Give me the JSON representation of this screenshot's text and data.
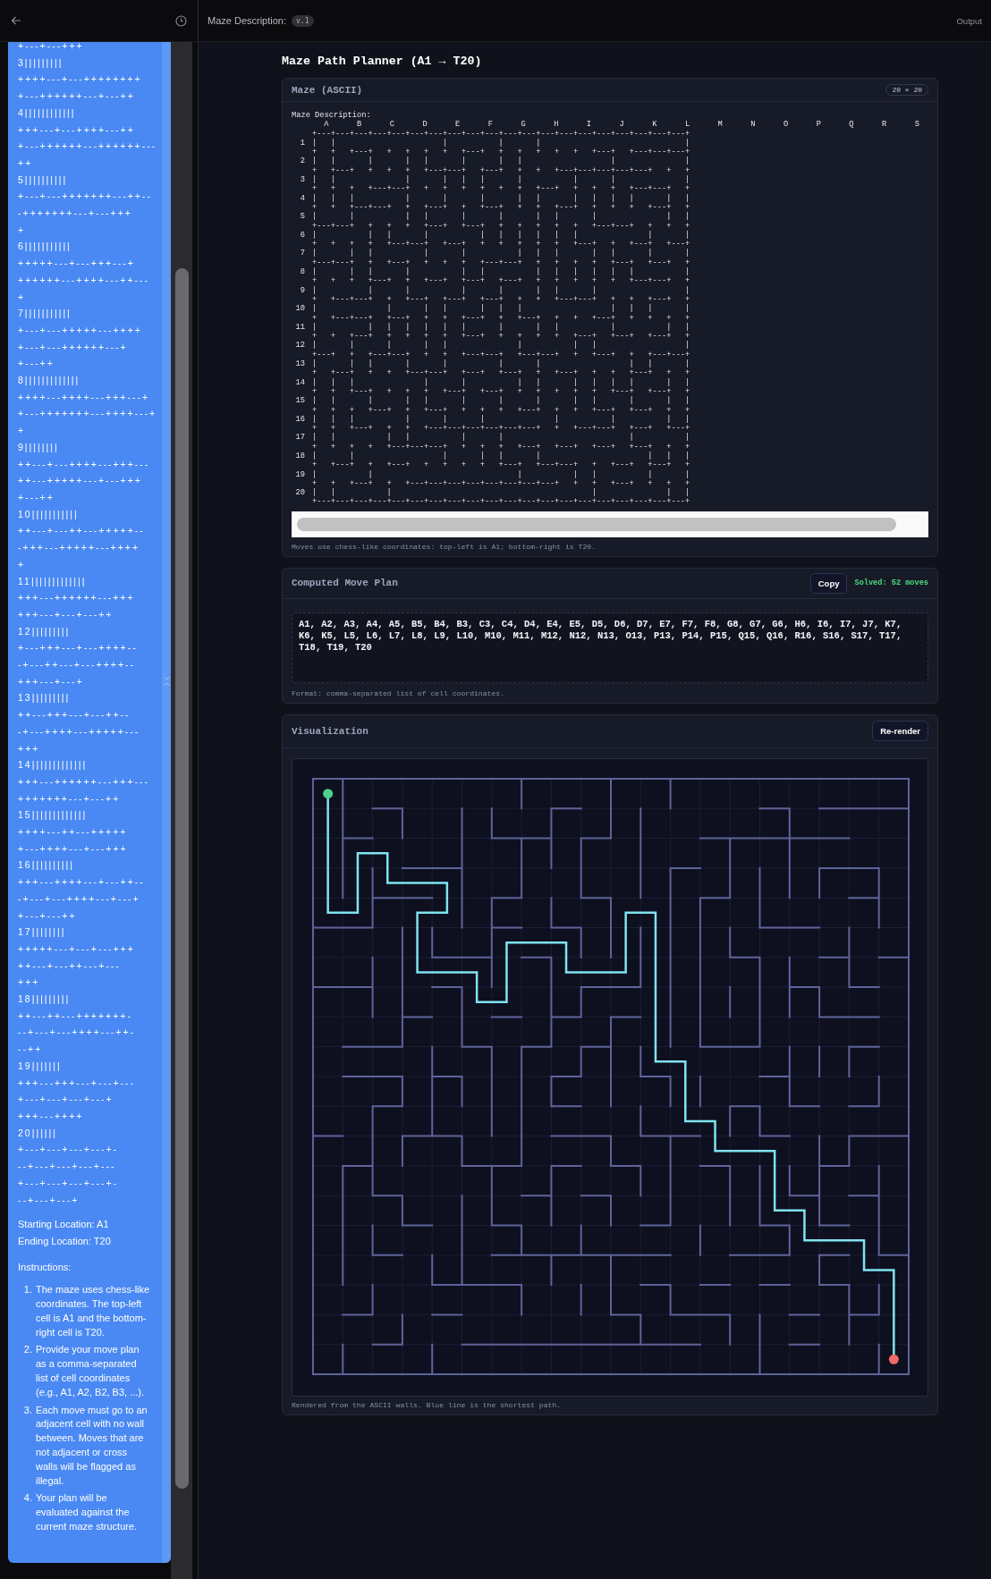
{
  "top_bar": {
    "title": "Maze Description:",
    "version": "v.1",
    "output_tab": "Output"
  },
  "sidebar": {
    "maze_text_lines": [
      "+---+---+++",
      "3|||||||||",
      "++++---+---++++++++",
      "+---++++++---+---++",
      "4||||||||||||",
      "+++---+---++++---++",
      "+---++++++---++++++---",
      "++",
      "5||||||||||",
      "+---+---+++++++---++--",
      "-+++++++---+---+++",
      "+",
      "6|||||||||||",
      "+++++---+---+++---+",
      "++++++---++++---++---",
      "+",
      "7|||||||||||",
      "+---+---+++++---++++",
      "+---+---++++++---+",
      "+---++",
      "8|||||||||||||",
      "++++---++++---+++---+",
      "+---+++++++---++++---+",
      "+",
      "9||||||||",
      "++---+---++++---+++---",
      "++---+++++---+---+++",
      "+---++",
      "10|||||||||||",
      "++---+---++---+++++--",
      "-+++---+++++---++++",
      "+",
      "11|||||||||||||",
      "+++---++++++---+++",
      "+++---+---+---++",
      "12|||||||||",
      "+---+++---+---++++--",
      "-+---++---+---++++--",
      "+++---+---+",
      "13|||||||||",
      "++---+++---+---++--",
      "-+---++++---+++++---",
      "+++",
      "14|||||||||||||",
      "+++---++++++---+++---",
      "+++++++---+---++",
      "15|||||||||||||",
      "++++---++---+++++",
      "+---++++---+---+++",
      "16||||||||||",
      "+++---++++---+---++--",
      "-+---+---++++---+---+",
      "+---+---++",
      "17||||||||",
      "+++++---+---+---+++",
      "++---+---++---+---",
      "+++",
      "18|||||||||",
      "++---++---+++++++-",
      "--+---+---++++---++-",
      "--++",
      "19|||||||",
      "+++---+++---+---+---",
      "+---+---+---+---+",
      "+++---++++",
      "20||||||",
      "+---+---+---+---+-",
      "--+---+---+---+---",
      "+---+---+---+---+-",
      "--+---+---+"
    ],
    "start_location": "Starting Location: A1",
    "end_location": "Ending Location: T20",
    "instructions_label": "Instructions:",
    "instructions": [
      {
        "number": "1.",
        "text": "The maze uses chess-like coordinates. The top-left cell is A1 and the bottom-right cell is T20."
      },
      {
        "number": "2.",
        "text": "Provide your move plan as a comma-separated list of cell coordinates (e.g., A1, A2, B2, B3, ...)."
      },
      {
        "number": "3.",
        "text": "Each move must go to an adjacent cell with no wall between. Moves that are not adjacent or cross walls will be flagged as illegal."
      },
      {
        "number": "4.",
        "text": "Your plan will be evaluated against the current maze structure."
      }
    ]
  },
  "page_title": "Maze Path Planner (A1 → T20)",
  "maze_card": {
    "title": "Maze (ASCII)",
    "size_badge": "20 × 20",
    "description_label": "Maze Description:",
    "column_labels": [
      "A",
      "B",
      "C",
      "D",
      "E",
      "F",
      "G",
      "H",
      "I",
      "J",
      "K",
      "L",
      "M",
      "N",
      "O",
      "P",
      "Q",
      "R",
      "S"
    ],
    "grid_lines": [
      {
        "line": "+---+---+---+---+---+---+---+---+---+---+---+---+---+---+---+---+---+---+---+---+"
      },
      {
        "row": "1",
        "line": "|   |                       |           |       |                               |"
      },
      {
        "line": "+   +   +---+   +   +   +   +   +---+   +   +   +   +   +   +---+   +---+---+---+"
      },
      {
        "row": "2",
        "line": "|   |       |       |   |       |       |   |                   |               |"
      },
      {
        "line": "+   +---+   +   +   +   +---+---+   +---+   +   +   +---+---+---+---+---+   +   +"
      },
      {
        "row": "3",
        "line": "|   |               |       |   |   |       |           |       |               |"
      },
      {
        "line": "+   +   +   +---+---+   +   +   +   +   +   +   +---+   +   +   +   +---+---+   +"
      },
      {
        "row": "4",
        "line": "|   |   |           |       |       |       |   |       |   |   |   |       |   |"
      },
      {
        "line": "+   +   +---+---+   +   +---+   +   +---+   +   +   +---+   +   +   +   +---+   +"
      },
      {
        "row": "5",
        "line": "|       |           |   |       |       |       |   |       |               |   |"
      },
      {
        "line": "+---+---+   +   +   +   +---+   +---+   +   +   +   +   +   +---+---+   +   +   +"
      },
      {
        "row": "6",
        "line": "|           |   |       |           |   |   |   |   |   |               |       |"
      },
      {
        "line": "+   +   +   +   +---+---+   +---+   +   +   +   +   +   +---+   +   +---+   +---+"
      },
      {
        "row": "7",
        "line": "|       |   |           |       |           |   |   |       |   |       |       |"
      },
      {
        "line": "+---+---+   +   +---+   +   +   +   +---+---+   +   +   +   +   +---+   +---+   +"
      },
      {
        "row": "8",
        "line": "|       |   |       |           |   |           |   |   |   |   |   |           |"
      },
      {
        "line": "+   +   +   +---+   +   +---+   +---+   +---+   +   +   +   +   +   +---+---+   +"
      },
      {
        "row": "9",
        "line": "|           |       |           |       |       |   |       |                   |"
      },
      {
        "line": "+   +---+---+   +   +---+   +---+   +---+   +   +   +---+---+   +   +   +---+   +"
      },
      {
        "row": "10",
        "line": "|               |       |   |       |   |   |                   |   |   |       |"
      },
      {
        "line": "+   +---+---+   +---+   +   +   +---+   +   +---+   +   +   +---+   +   +   +   +"
      },
      {
        "row": "11",
        "line": "|           |   |   |   |   |   |       |       |   |           |           |   |"
      },
      {
        "line": "+   +   +---+   +   +   +   +   +---+   +   +   +   +   +---+   +---+   +---+   +"
      },
      {
        "row": "12",
        "line": "|       |       |       |   |               |           |   |                   |"
      },
      {
        "line": "+---+   +   +---+---+   +   +   +---+---+   +---+---+   +   +---+   +   +---+---+"
      },
      {
        "row": "13",
        "line": "|       |   |       |       |           |       |                   |   |       |"
      },
      {
        "line": "+   +---+   +   +   +---+---+   +---+   +---+   +   +---+   +   +   +---+   +   +"
      },
      {
        "row": "14",
        "line": "|   |   |               |       |           |   |       |   |   |   |       |   |"
      },
      {
        "line": "+   +   +---+   +   +   +   +---+   +---+   +   +   +   +   +   +---+   +---+   +"
      },
      {
        "row": "15",
        "line": "|   |       |       |   |       |       |       |       |   |       |       |   |"
      },
      {
        "line": "+   +   +   +---+   +   +---+   +   +   +   +---+   +   +   +---+   +---+   +   +"
      },
      {
        "row": "16",
        "line": "|   |   |           |       |       |               |           |           |   |"
      },
      {
        "line": "+   +   +---+   +   +   +---+---+---+---+---+---+   +   +---+---+   +---+   +---+"
      },
      {
        "row": "17",
        "line": "|   |           |   |           |       |                           |           |"
      },
      {
        "line": "+   +   +   +   +---+---+---+   +   +   +   +---+   +---+   +---+   +---+   +   +"
      },
      {
        "row": "18",
        "line": "|       |                   |       |   |       |                       |   |   |"
      },
      {
        "line": "+   +---+   +   +---+   +   +   +   +   +---+   +---+---+   +   +---+   +---+   +"
      },
      {
        "row": "19",
        "line": "|           |                               |           |   |           |       |"
      },
      {
        "line": "+   +   +---+   +   +---+---+---+---+---+---+---+---+   +   +   +---+   +   +   +"
      },
      {
        "row": "20",
        "line": "|   |           |                                           |               |   |"
      },
      {
        "line": "+---+---+---+---+---+---+---+---+---+---+---+---+---+---+---+---+---+---+---+---+"
      }
    ],
    "caption": "Moves use chess-like coordinates: top-left is A1; bottom-right is T20."
  },
  "plan_card": {
    "title": "Computed Move Plan",
    "copy_button": "Copy",
    "status": "Solved: 52 moves",
    "moves": "A1, A2, A3, A4, A5, B5, B4, B3, C3, C4, D4, E4, E5, D5, D6, D7, E7, F7, F8, G8, G7, G6, H6, I6, I7, J7, K7, K6, K5, L5, L6, L7, L8, L9, L10, M10, M11, M12, N12, N13, O13, P13, P14, P15, Q15, Q16, R16, S16, S17, T17, T18, T19, T20",
    "caption": "Format: comma-separated list of cell coordinates."
  },
  "visualization_card": {
    "title": "Visualization",
    "rerender_button": "Re-render",
    "caption": "Rendered from the ASCII walls. Blue line is the shortest path."
  }
}
